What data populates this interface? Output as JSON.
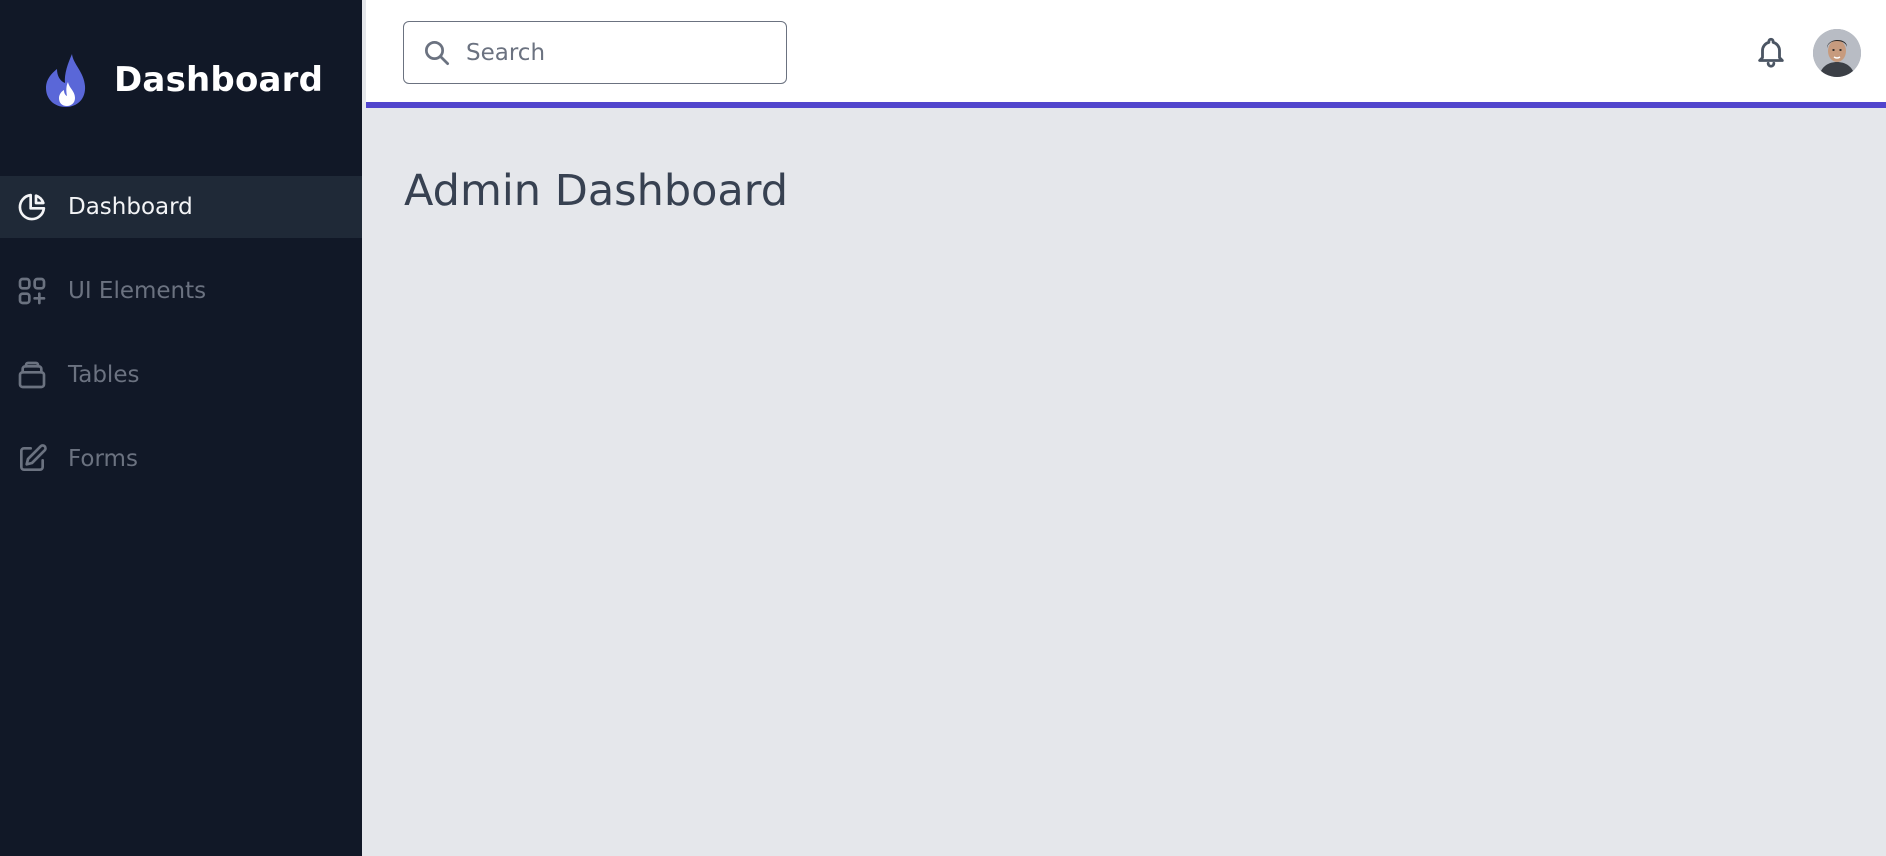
{
  "brand": {
    "title": "Dashboard"
  },
  "sidebar": {
    "items": [
      {
        "label": "Dashboard",
        "icon": "chart-pie-icon",
        "active": true
      },
      {
        "label": "UI Elements",
        "icon": "grid-plus-icon",
        "active": false
      },
      {
        "label": "Tables",
        "icon": "archive-tray-icon",
        "active": false
      },
      {
        "label": "Forms",
        "icon": "pencil-square-icon",
        "active": false
      }
    ]
  },
  "header": {
    "search": {
      "placeholder": "Search",
      "value": ""
    },
    "notification_icon": "bell-icon",
    "avatar_icon": "user-avatar"
  },
  "main": {
    "title": "Admin Dashboard"
  },
  "colors": {
    "sidebar_bg": "#111827",
    "sidebar_active_bg": "#1f2937",
    "accent": "#5145cd",
    "content_bg": "#e5e7eb",
    "header_bg": "#ffffff",
    "logo": "#5a67d8"
  }
}
